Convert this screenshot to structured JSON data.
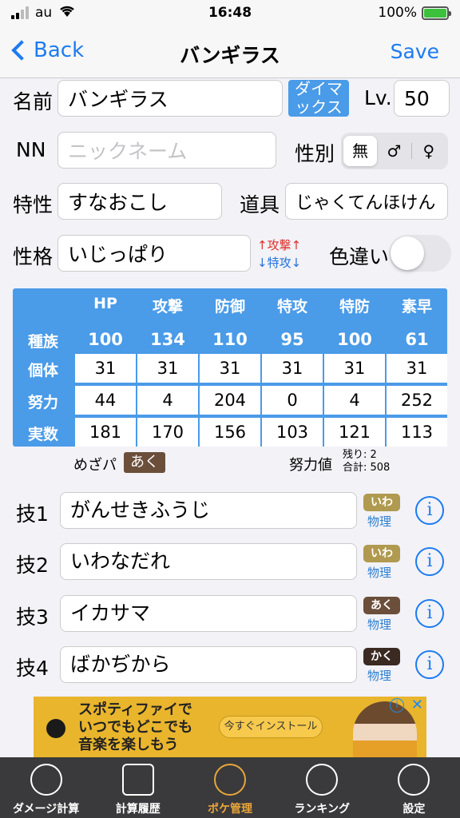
{
  "status_bar": {
    "carrier": "au",
    "time": "16:48",
    "battery": "100%"
  },
  "nav": {
    "back_label": "Back",
    "title": "バンギラス",
    "save_label": "Save"
  },
  "form": {
    "name_label": "名前",
    "name_value": "バンギラス",
    "dynamax_label": "ダイマックス",
    "level_label": "Lv.",
    "level_value": "50",
    "nickname_label": "NN",
    "nickname_placeholder": "ニックネーム",
    "gender_label": "性別",
    "gender_options": [
      "無",
      "♂",
      "♀"
    ],
    "gender_selected": "無",
    "ability_label": "特性",
    "ability_value": "すなおこし",
    "item_label": "道具",
    "item_value": "じゃくてんほけん",
    "nature_label": "性格",
    "nature_value": "いじっぱり",
    "nature_up": "↑攻撃↑",
    "nature_down": "↓特攻↓",
    "shiny_label": "色違い",
    "shiny_on": false
  },
  "stats": {
    "headers": [
      "HP",
      "攻撃",
      "防御",
      "特攻",
      "特防",
      "素早"
    ],
    "rows": [
      {
        "label": "種族",
        "values": [
          "100",
          "134",
          "110",
          "95",
          "100",
          "61"
        ]
      },
      {
        "label": "個体",
        "values": [
          "31",
          "31",
          "31",
          "31",
          "31",
          "31"
        ]
      },
      {
        "label": "努力",
        "values": [
          "44",
          "4",
          "204",
          "0",
          "4",
          "252"
        ]
      },
      {
        "label": "実数",
        "values": [
          "181",
          "170",
          "156",
          "103",
          "121",
          "113"
        ]
      }
    ],
    "hidden_power_label": "めざパ",
    "hidden_power_type": "あく",
    "ev_label": "努力値",
    "ev_remaining": "残り: 2",
    "ev_total": "合計: 508"
  },
  "moves": [
    {
      "label": "技1",
      "name": "がんせきふうじ",
      "type": "いわ",
      "type_color": "#b09a4f",
      "category": "物理"
    },
    {
      "label": "技2",
      "name": "いわなだれ",
      "type": "いわ",
      "type_color": "#b09a4f",
      "category": "物理"
    },
    {
      "label": "技3",
      "name": "イカサマ",
      "type": "あく",
      "type_color": "#6b4f3a",
      "category": "物理"
    },
    {
      "label": "技4",
      "name": "ばかぢから",
      "type": "かく",
      "type_color": "#3a2a22",
      "category": "物理"
    }
  ],
  "ad": {
    "line1": "スポティファイで",
    "line2": "いつでもどこでも",
    "line3": "音楽を楽しもう",
    "cta": "今すぐインストール"
  },
  "tabs": [
    {
      "label": "ダメージ計算",
      "icon": "damage-calc-icon",
      "active": false
    },
    {
      "label": "計算履歴",
      "icon": "history-icon",
      "active": false
    },
    {
      "label": "ポケ管理",
      "icon": "poke-manage-icon",
      "active": true
    },
    {
      "label": "ランキング",
      "icon": "ranking-icon",
      "active": false
    },
    {
      "label": "設定",
      "icon": "settings-icon",
      "active": false
    }
  ],
  "colors": {
    "accent": "#1d7bf0",
    "table": "#4a9be8",
    "tab_active": "#e8a63a"
  }
}
